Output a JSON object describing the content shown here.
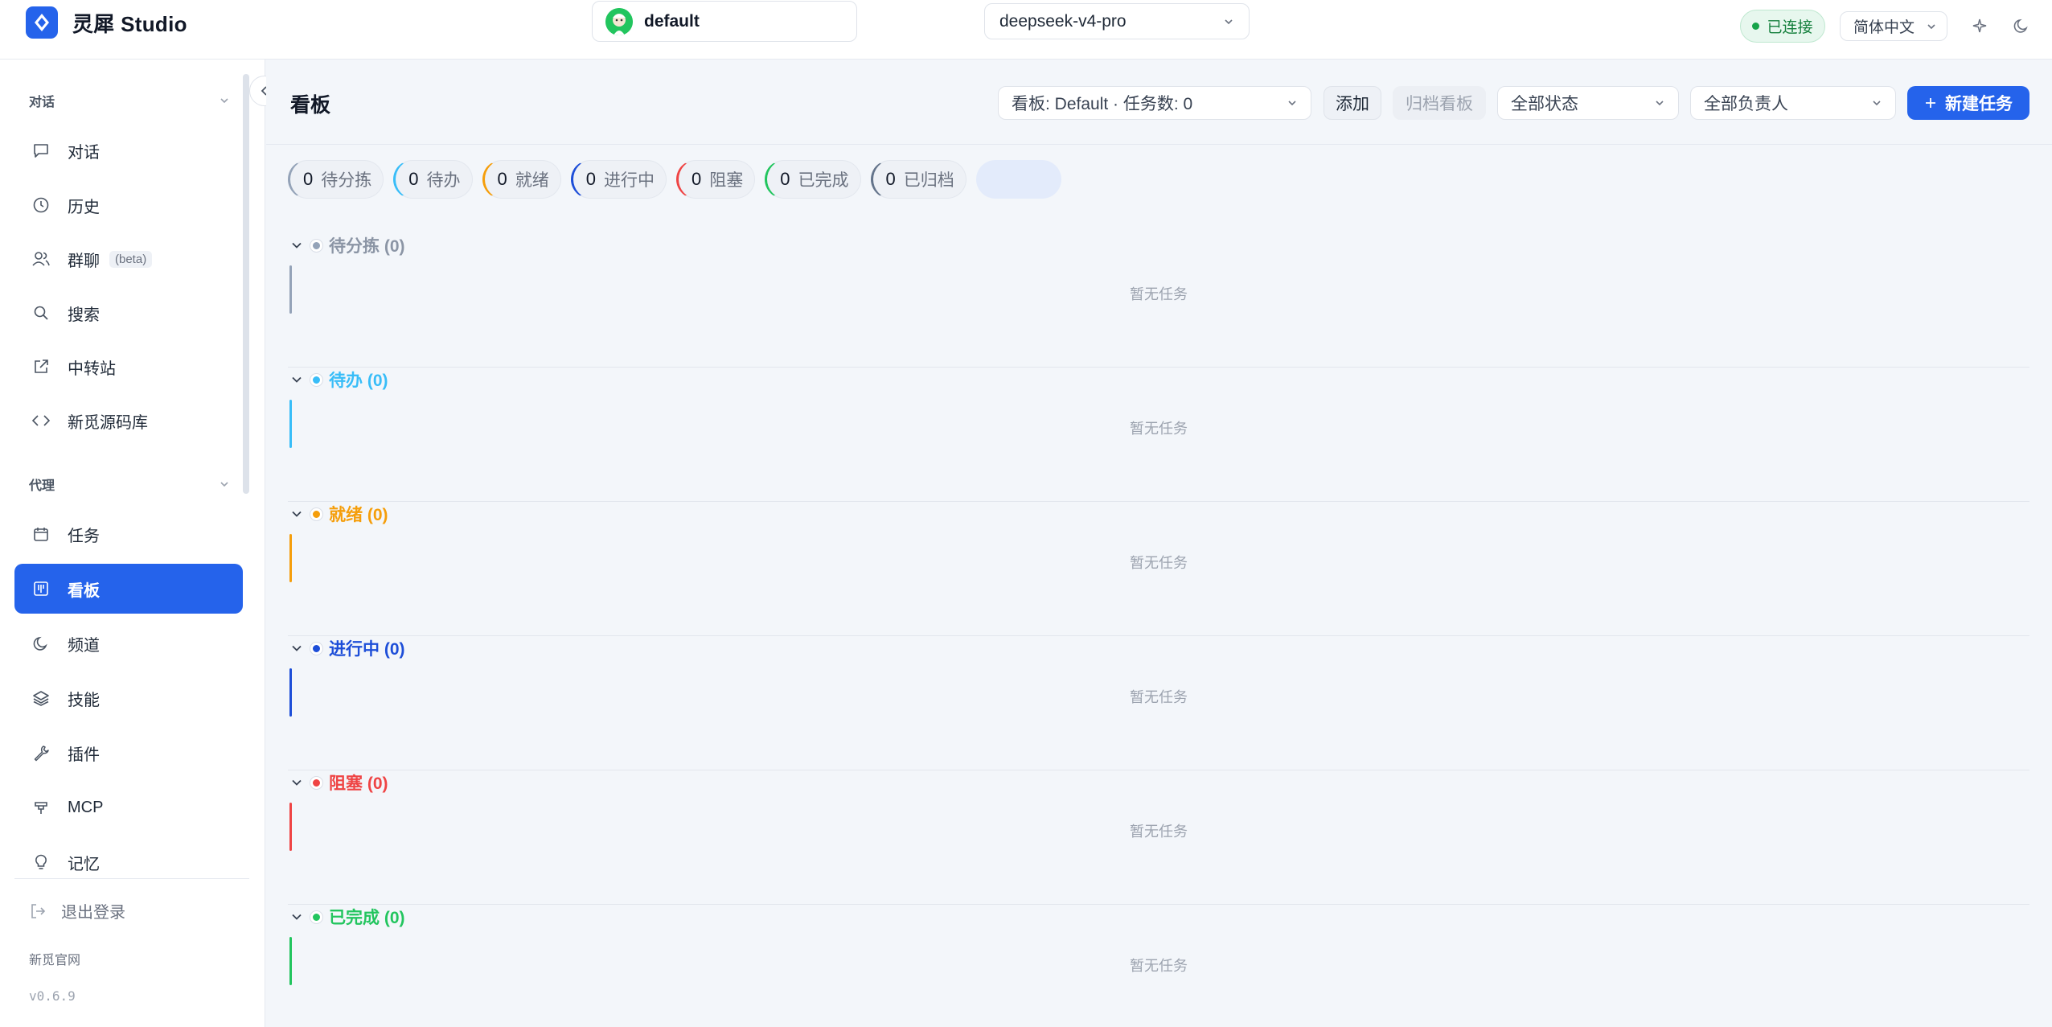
{
  "app": {
    "name": "灵犀 Studio",
    "profile": "default",
    "model": "deepseek-v4-pro",
    "connection": "已连接",
    "language": "简体中文"
  },
  "sidebar": {
    "group_chat": "对话",
    "group_agent": "代理",
    "chat_items": [
      {
        "label": "对话",
        "icon": "message-icon"
      },
      {
        "label": "历史",
        "icon": "clock-icon"
      },
      {
        "label": "群聊",
        "icon": "users-icon",
        "badge": "(beta)"
      },
      {
        "label": "搜索",
        "icon": "search-icon"
      },
      {
        "label": "中转站",
        "icon": "external-link-icon"
      },
      {
        "label": "新觅源码库",
        "icon": "code-icon"
      }
    ],
    "agent_items": [
      {
        "label": "任务",
        "icon": "calendar-icon"
      },
      {
        "label": "看板",
        "icon": "kanban-icon",
        "active": true
      },
      {
        "label": "频道",
        "icon": "moon-icon"
      },
      {
        "label": "技能",
        "icon": "layers-icon"
      },
      {
        "label": "插件",
        "icon": "wrench-icon"
      },
      {
        "label": "MCP",
        "icon": "plug-icon"
      },
      {
        "label": "记忆",
        "icon": "lightbulb-icon"
      }
    ],
    "logout": "退出登录",
    "site": "新觅官网",
    "version": "v0.6.9"
  },
  "header": {
    "title": "看板",
    "board_select": "看板: Default · 任务数: 0",
    "add": "添加",
    "archive": "归档看板",
    "status_filter": "全部状态",
    "assignee_filter": "全部负责人",
    "new_task": "新建任务"
  },
  "chips": [
    {
      "count": "0",
      "label": "待分拣",
      "color": "#94a3b8"
    },
    {
      "count": "0",
      "label": "待办",
      "color": "#38bdf8"
    },
    {
      "count": "0",
      "label": "就绪",
      "color": "#f59e0b"
    },
    {
      "count": "0",
      "label": "进行中",
      "color": "#1d4ed8"
    },
    {
      "count": "0",
      "label": "阻塞",
      "color": "#ef4444"
    },
    {
      "count": "0",
      "label": "已完成",
      "color": "#22c55e"
    },
    {
      "count": "0",
      "label": "已归档",
      "color": "#64748b"
    }
  ],
  "lanes": [
    {
      "title": "待分拣 (0)",
      "color": "#94a3b8",
      "text_color": "#8b95a5",
      "empty": "暂无任务"
    },
    {
      "title": "待办 (0)",
      "color": "#38bdf8",
      "text_color": "#38bdf8",
      "empty": "暂无任务"
    },
    {
      "title": "就绪 (0)",
      "color": "#f59e0b",
      "text_color": "#f59e0b",
      "empty": "暂无任务"
    },
    {
      "title": "进行中 (0)",
      "color": "#1d4ed8",
      "text_color": "#1d4ed8",
      "empty": "暂无任务"
    },
    {
      "title": "阻塞 (0)",
      "color": "#ef4444",
      "text_color": "#ef4444",
      "empty": "暂无任务"
    },
    {
      "title": "已完成 (0)",
      "color": "#22c55e",
      "text_color": "#22c55e",
      "empty": "暂无任务"
    }
  ]
}
